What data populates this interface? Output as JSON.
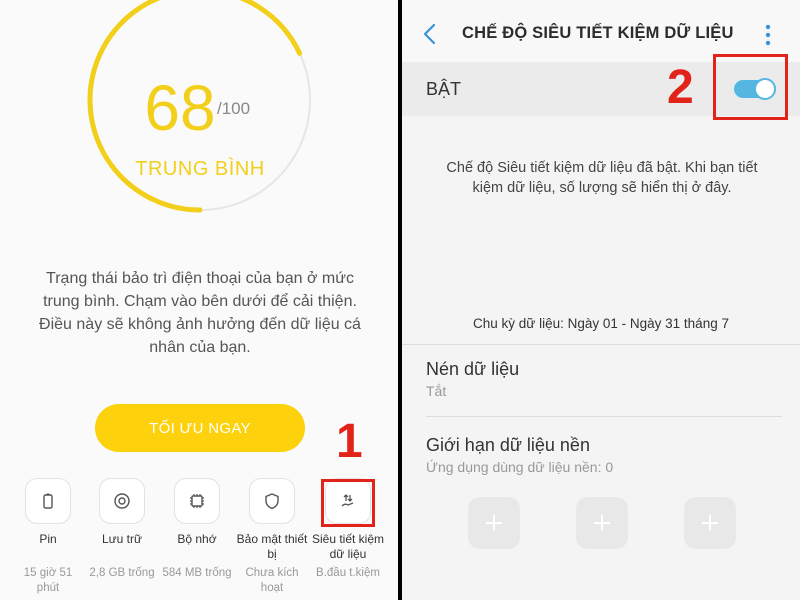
{
  "left_panel": {
    "score": {
      "value": "68",
      "max": "/100",
      "status": "TRUNG BÌNH",
      "fraction": 0.68,
      "color": "#f2cf1b"
    },
    "description": "Trạng thái bảo trì điện thoại của bạn ở mức trung bình. Chạm vào bên dưới để cải thiện. Điều này sẽ không ảnh hưởng đến dữ liệu cá nhân của bạn.",
    "optimize_button": "TỐI ƯU NGAY",
    "tools": [
      {
        "label": "Pin",
        "value": "15 giờ 51 phút",
        "icon": "battery-icon"
      },
      {
        "label": "Lưu trữ",
        "value": "2,8 GB trống",
        "icon": "storage-icon"
      },
      {
        "label": "Bộ nhớ",
        "value": "584 MB trống",
        "icon": "memory-chip-icon"
      },
      {
        "label": "Bảo mật thiết bị",
        "value": "Chưa kích hoạt",
        "icon": "shield-icon"
      },
      {
        "label": "Siêu tiết kiệm dữ liệu",
        "value": "B.đầu t.kiệm",
        "icon": "data-saver-icon"
      }
    ],
    "annotation_number": "1"
  },
  "right_panel": {
    "title": "CHẾ ĐỘ SIÊU TIẾT KIỆM DỮ LIỆU",
    "toggle": {
      "label": "BẬT",
      "on": true,
      "color": "#55b7e1"
    },
    "annotation_number": "2",
    "info_text": "Chế độ Siêu tiết kiệm dữ liệu đã bật. Khi bạn tiết kiệm dữ liệu, số lượng sẽ hiển thị ở đây.",
    "cycle_text": "Chu kỳ dữ liệu: Ngày 01 - Ngày 31 tháng 7",
    "settings": [
      {
        "title": "Nén dữ liệu",
        "subtitle": "Tắt"
      },
      {
        "title": "Giới hạn dữ liệu nền",
        "subtitle": "Ứng dụng dùng dữ liệu nền: 0"
      }
    ]
  },
  "colors": {
    "accent_yellow": "#fdd10b",
    "annotation_red": "#e2231a",
    "toggle_blue": "#55b7e1"
  }
}
